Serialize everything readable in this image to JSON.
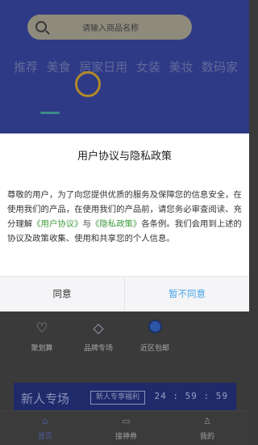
{
  "search": {
    "placeholder": "请输入商品名称"
  },
  "categories": [
    "推荐",
    "美食",
    "居家日用",
    "女装",
    "美妆",
    "数码家"
  ],
  "quick_links": [
    {
      "icon": "heart-icon",
      "label": "聚划算"
    },
    {
      "icon": "tag-icon",
      "label": "品牌专场"
    },
    {
      "icon": "location-badge-icon",
      "label": "近区包邮"
    }
  ],
  "promo": {
    "title": "新人专场",
    "tag": "新人专享福利",
    "countdown": "24 : 59 : 59"
  },
  "tabbar": [
    {
      "icon": "home-icon",
      "label": "首页",
      "active": true
    },
    {
      "icon": "coupon-icon",
      "label": "接神券",
      "active": false
    },
    {
      "icon": "user-icon",
      "label": "我的",
      "active": false
    }
  ],
  "dialog": {
    "title": "用户协议与隐私政策",
    "body_1": "尊敬的用户，为了向您提供优质的服务及保障您的信息安全，在使用我们的产品，在使用我们的产品前，请您务必审查阅读、充分理解",
    "link_agreement": "《用户协议》",
    "body_and": "与",
    "link_privacy": "《隐私政策》",
    "body_2": "各条例。我们会用到上述的协议及政策收集、使用和共享您的个人信息。",
    "agree_label": "同意",
    "decline_label": "暂不同意"
  },
  "colors": {
    "link": "#3f9b3f",
    "decline": "#4aa5e8",
    "hero_bg": "#2e3a86"
  }
}
